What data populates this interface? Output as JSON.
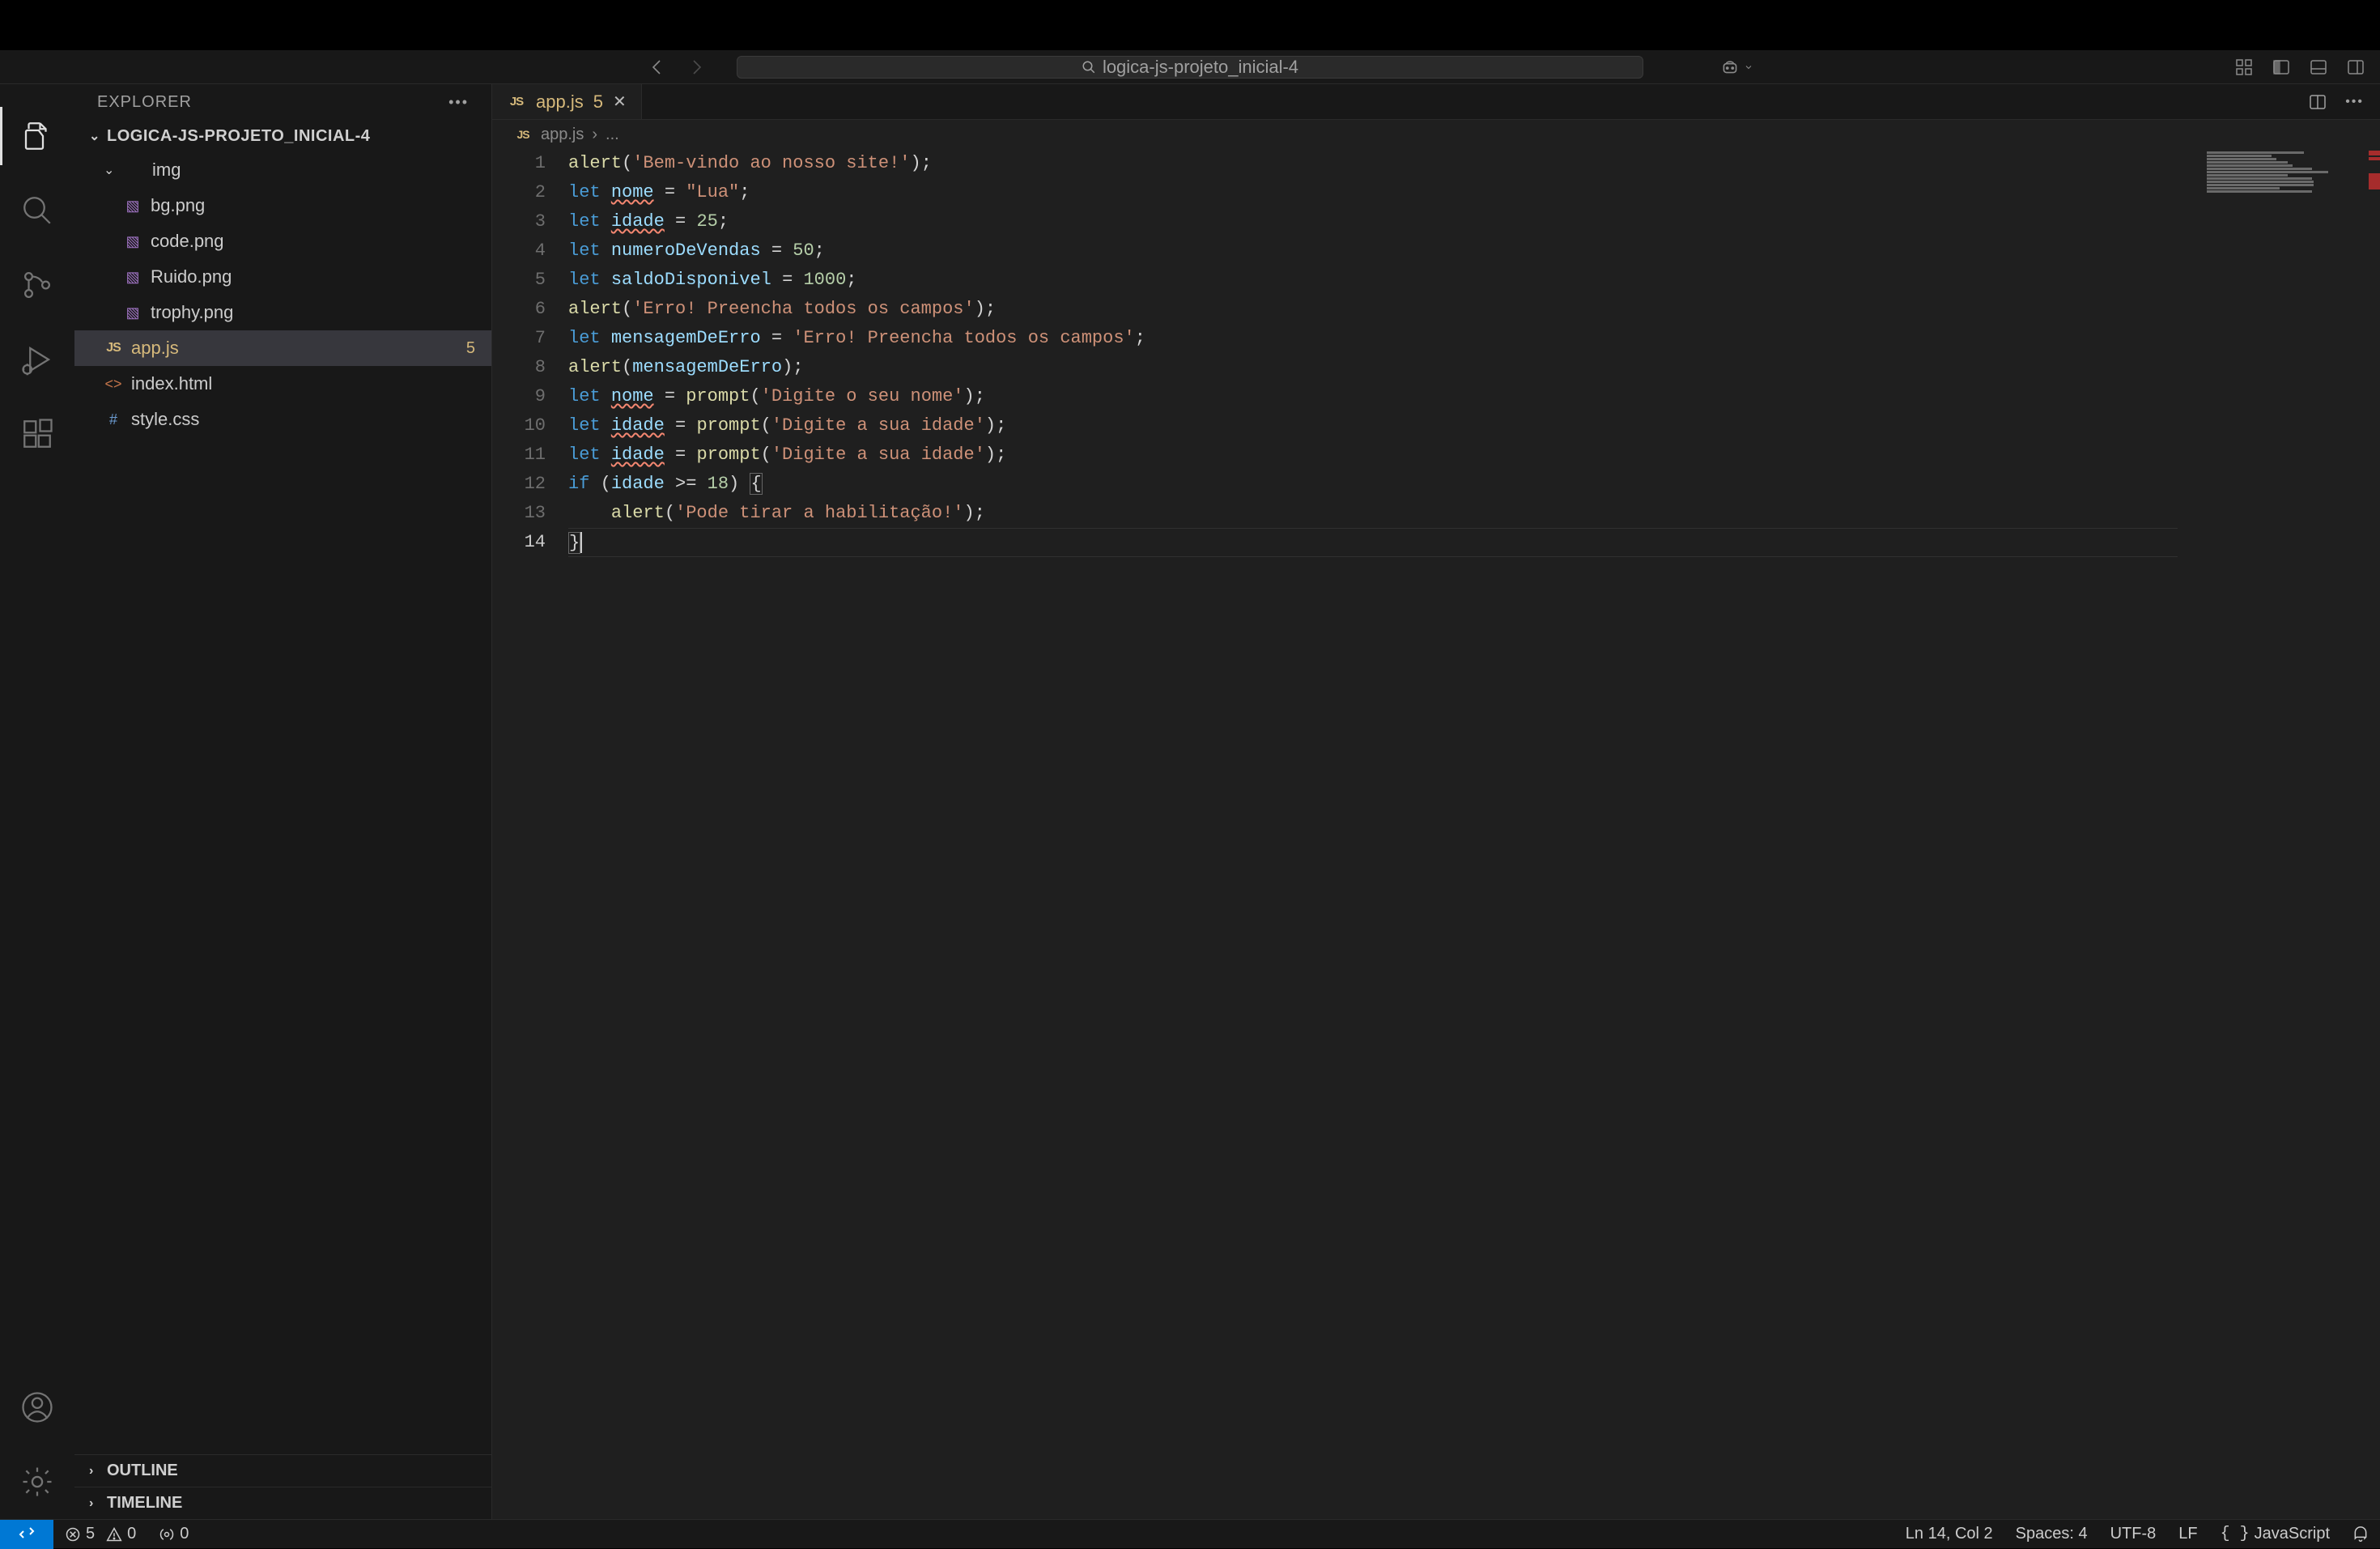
{
  "titlebar": {
    "search_text": "logica-js-projeto_inicial-4"
  },
  "sidebar": {
    "title": "EXPLORER",
    "folder_name": "LOGICA-JS-PROJETO_INICIAL-4",
    "tree": {
      "img_folder": "img",
      "files_in_img": [
        "bg.png",
        "code.png",
        "Ruido.png",
        "trophy.png"
      ],
      "app_js": "app.js",
      "app_js_badge": "5",
      "index_html": "index.html",
      "style_css": "style.css"
    },
    "outline": "OUTLINE",
    "timeline": "TIMELINE"
  },
  "tab": {
    "filename": "app.js",
    "error_count": "5"
  },
  "breadcrumb": {
    "file": "app.js",
    "more": "..."
  },
  "code": {
    "lines": [
      {
        "n": "1",
        "tokens": [
          [
            "fn",
            "alert"
          ],
          [
            "p",
            "("
          ],
          [
            "s",
            "'Bem-vindo ao nosso site!'"
          ],
          [
            "p",
            ")"
          ],
          [
            "p",
            ";"
          ]
        ]
      },
      {
        "n": "2",
        "tokens": [
          [
            "kw",
            "let"
          ],
          [
            "sp",
            " "
          ],
          [
            "varsq",
            "nome"
          ],
          [
            "sp",
            " "
          ],
          [
            "p",
            "="
          ],
          [
            "sp",
            " "
          ],
          [
            "s",
            "\"Lua\""
          ],
          [
            "p",
            ";"
          ]
        ]
      },
      {
        "n": "3",
        "tokens": [
          [
            "kw",
            "let"
          ],
          [
            "sp",
            " "
          ],
          [
            "varsq",
            "idade"
          ],
          [
            "sp",
            " "
          ],
          [
            "p",
            "="
          ],
          [
            "sp",
            " "
          ],
          [
            "num",
            "25"
          ],
          [
            "p",
            ";"
          ]
        ]
      },
      {
        "n": "4",
        "tokens": [
          [
            "kw",
            "let"
          ],
          [
            "sp",
            " "
          ],
          [
            "var",
            "numeroDeVendas"
          ],
          [
            "sp",
            " "
          ],
          [
            "p",
            "="
          ],
          [
            "sp",
            " "
          ],
          [
            "num",
            "50"
          ],
          [
            "p",
            ";"
          ]
        ]
      },
      {
        "n": "5",
        "tokens": [
          [
            "kw",
            "let"
          ],
          [
            "sp",
            " "
          ],
          [
            "var",
            "saldoDisponivel"
          ],
          [
            "sp",
            " "
          ],
          [
            "p",
            "="
          ],
          [
            "sp",
            " "
          ],
          [
            "num",
            "1000"
          ],
          [
            "p",
            ";"
          ]
        ]
      },
      {
        "n": "6",
        "tokens": [
          [
            "fn",
            "alert"
          ],
          [
            "p",
            "("
          ],
          [
            "s",
            "'Erro! Preencha todos os campos'"
          ],
          [
            "p",
            ")"
          ],
          [
            "p",
            ";"
          ]
        ]
      },
      {
        "n": "7",
        "tokens": [
          [
            "kw",
            "let"
          ],
          [
            "sp",
            " "
          ],
          [
            "var",
            "mensagemDeErro"
          ],
          [
            "sp",
            " "
          ],
          [
            "p",
            "="
          ],
          [
            "sp",
            " "
          ],
          [
            "s",
            "'Erro! Preencha todos os campos'"
          ],
          [
            "p",
            ";"
          ]
        ]
      },
      {
        "n": "8",
        "tokens": [
          [
            "fn",
            "alert"
          ],
          [
            "p",
            "("
          ],
          [
            "var",
            "mensagemDeErro"
          ],
          [
            "p",
            ")"
          ],
          [
            "p",
            ";"
          ]
        ]
      },
      {
        "n": "9",
        "tokens": [
          [
            "kw",
            "let"
          ],
          [
            "sp",
            " "
          ],
          [
            "varsq",
            "nome"
          ],
          [
            "sp",
            " "
          ],
          [
            "p",
            "="
          ],
          [
            "sp",
            " "
          ],
          [
            "fn",
            "prompt"
          ],
          [
            "p",
            "("
          ],
          [
            "s",
            "'Digite o seu nome'"
          ],
          [
            "p",
            ")"
          ],
          [
            "p",
            ";"
          ]
        ]
      },
      {
        "n": "10",
        "tokens": [
          [
            "kw",
            "let"
          ],
          [
            "sp",
            " "
          ],
          [
            "varsq",
            "idade"
          ],
          [
            "sp",
            " "
          ],
          [
            "p",
            "="
          ],
          [
            "sp",
            " "
          ],
          [
            "fn",
            "prompt"
          ],
          [
            "p",
            "("
          ],
          [
            "s",
            "'Digite a sua idade'"
          ],
          [
            "p",
            ")"
          ],
          [
            "p",
            ";"
          ]
        ]
      },
      {
        "n": "11",
        "tokens": [
          [
            "kw",
            "let"
          ],
          [
            "sp",
            " "
          ],
          [
            "varsq",
            "idade"
          ],
          [
            "sp",
            " "
          ],
          [
            "p",
            "="
          ],
          [
            "sp",
            " "
          ],
          [
            "fn",
            "prompt"
          ],
          [
            "p",
            "("
          ],
          [
            "s",
            "'Digite a sua idade'"
          ],
          [
            "p",
            ")"
          ],
          [
            "p",
            ";"
          ]
        ]
      },
      {
        "n": "12",
        "tokens": [
          [
            "kw",
            "if"
          ],
          [
            "sp",
            " "
          ],
          [
            "p",
            "("
          ],
          [
            "var",
            "idade"
          ],
          [
            "sp",
            " "
          ],
          [
            "p",
            ">="
          ],
          [
            "sp",
            " "
          ],
          [
            "num",
            "18"
          ],
          [
            "p",
            ")"
          ],
          [
            "sp",
            " "
          ],
          [
            "brace",
            "{"
          ]
        ]
      },
      {
        "n": "13",
        "tokens": [
          [
            "sp",
            "    "
          ],
          [
            "fn",
            "alert"
          ],
          [
            "p",
            "("
          ],
          [
            "s",
            "'Pode tirar a habilitação!'"
          ],
          [
            "p",
            ")"
          ],
          [
            "p",
            ";"
          ]
        ]
      },
      {
        "n": "14",
        "current": true,
        "tokens": [
          [
            "brace",
            "}"
          ],
          [
            "cursor",
            ""
          ]
        ]
      }
    ]
  },
  "statusbar": {
    "errors": "5",
    "warnings": "0",
    "ports": "0",
    "ln_col": "Ln 14, Col 2",
    "spaces": "Spaces: 4",
    "encoding": "UTF-8",
    "eol": "LF",
    "language": "JavaScript"
  }
}
